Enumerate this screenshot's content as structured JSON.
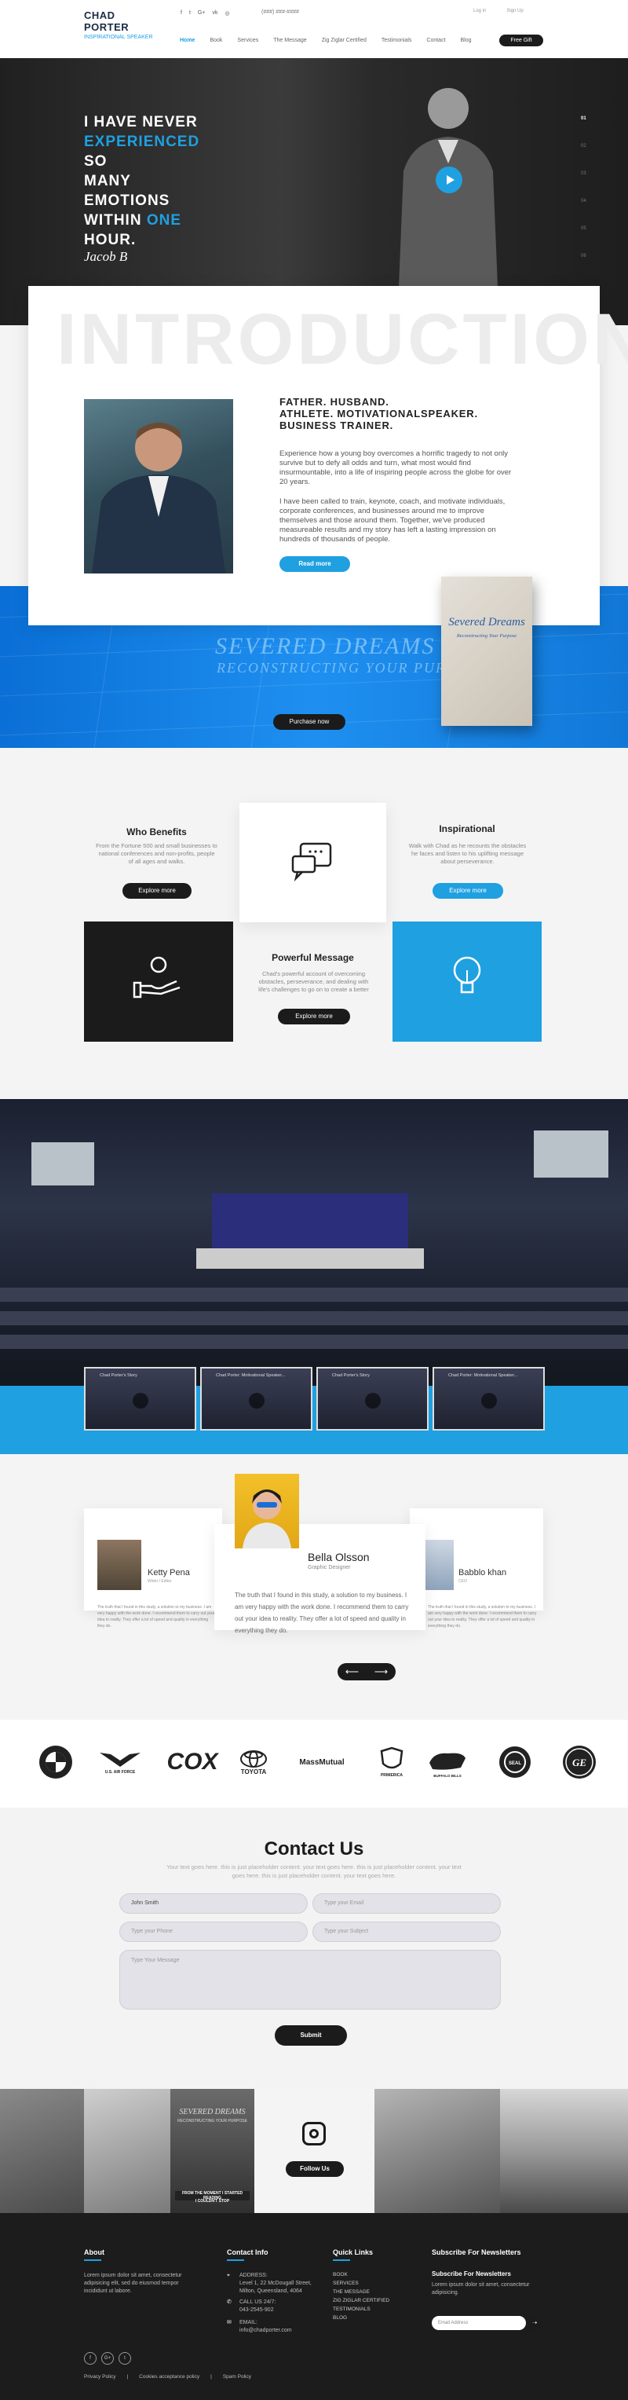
{
  "header": {
    "logo_line1": "CHAD PORTER",
    "logo_line2": "INSPIRATIONAL SPEAKER",
    "social_icons": [
      "facebook-icon",
      "twitter-icon",
      "google-plus-icon",
      "vk-icon",
      "instagram-icon"
    ],
    "phone": "(###) ###-####",
    "top_links": [
      "Log in",
      "Sign Up"
    ],
    "nav": [
      "Home",
      "Book",
      "Services",
      "The Message",
      "Zig Ziglar Certified",
      "Testimonials",
      "Contact",
      "Blog"
    ],
    "cta": "Free Gift",
    "brand_color": "#1fa0e0"
  },
  "hero": {
    "line1": "I HAVE NEVER",
    "line2_accent": "EXPERIENCED",
    "line2_rest": " SO",
    "line3": "MANY EMOTIONS",
    "line4_pre": "WITHIN ",
    "line4_accent": "ONE",
    "line5": "HOUR.",
    "signature": "Jacob B",
    "pager": [
      "01",
      "02",
      "03",
      "04",
      "05",
      "06"
    ]
  },
  "intro": {
    "watermark": "INTRODUCTION",
    "heading_l1": "FATHER. HUSBAND.",
    "heading_l2": "ATHLETE. MOTIVATIONALSPEAKER.",
    "heading_l3": "BUSINESS TRAINER.",
    "para1": "Experience how a young boy overcomes a horrific tragedy to not only survive but to defy all odds and turn, what most would find insurmountable, into a life of inspiring people across the globe for over 20 years.",
    "para2": "I have been called to train, keynote, coach, and motivate individuals, corporate conferences, and businesses around me to improve themselves and those around them. Together, we've produced measureable results and my story has left a lasting impression on hundreds of thousands of people.",
    "read_more": "Read more"
  },
  "book": {
    "title1": "SEVERED DREAMS",
    "title2": "RECONSTRUCTING YOUR PURPOSE",
    "purchase": "Purchase now",
    "cover_title": "Severed Dreams",
    "cover_sub": "Reconstructing Your Purpose"
  },
  "benefits": {
    "who_title": "Who Benefits",
    "who_text": "From the Fortune 500 and small businesses to national conferences and non-profits, people of all ages and walks.",
    "who_btn": "Explore more",
    "insp_title": "Inspirational",
    "insp_text": "Walk with Chad as he recounts the obstacles he faces and listen to his uplifting message about perseverance.",
    "insp_btn": "Explore more",
    "pm_title": "Powerful Message",
    "pm_text": "Chad's powerful account of overcoming obstacles, perseverance, and dealing with life's challenges to go on to create a better",
    "pm_btn": "Explore more"
  },
  "videos": [
    {
      "title": "Chad Porter's Story"
    },
    {
      "title": "Chad Porter: Motivational Speaker..."
    },
    {
      "title": "Chad Porter's Story"
    },
    {
      "title": "Chad Porter: Motivational Speaker..."
    }
  ],
  "testimonials": {
    "left": {
      "name": "Ketty Pena",
      "role": "Writer / Editor",
      "text": "The truth that I found in this study, a solution to my business. I am very happy with the work done. I recommend them to carry out your idea to reality. They offer a lot of speed and quality in everything they do."
    },
    "main": {
      "name": "Bella Olsson",
      "role": "Graphic Designer",
      "text": "The truth that I found in this study, a solution to my business. I am very happy with the work done. I recommend them to carry out your idea to reality. They offer a lot of speed and quality in everything they do."
    },
    "right": {
      "name": "Babblo khan",
      "role": "CEO",
      "text": "The truth that I found in this study, a solution to my business. I am very happy with the work done. I recommend them to carry out your idea to reality. They offer a lot of speed and quality in everything they do."
    },
    "prev": "⟵",
    "next": "⟶"
  },
  "logos": [
    "BMW",
    "U.S. AIR FORCE",
    "COX",
    "TOYOTA",
    "MassMutual",
    "PRIMERICA",
    "BUFFALO BILLS",
    "SEAL",
    "GE"
  ],
  "contact": {
    "title": "Contact Us",
    "sub": "Your text goes here. this is just placeholder content. your text goes here. this is just placeholder content. your text goes here. this is just placeholder content. your text goes here.",
    "name_value": "John Smith",
    "email_ph": "Type your Email",
    "phone_ph": "Type your Phone",
    "subject_ph": "Type your Subject",
    "message_ph": "Type Your Message",
    "submit": "Submit"
  },
  "instagram": {
    "follow": "Follow Us",
    "poster1": "SEVERED DREAMS",
    "poster2": "RECONSTRUCTING YOUR PURPOSE",
    "poster3": "FROM THE MOMENT I STARTED READING",
    "poster4": "I COULDN'T STOP"
  },
  "footer": {
    "about_h": "About",
    "about_text": "Lorem ipsum dolor sit amet, consectetur adipisicing elit, sed do eiusmod tempor incididunt ut labore.",
    "contact_h": "Contact Info",
    "address_label": "ADDRESS:",
    "address": "Level 1, 22 McDougall Street, Milton, Queensland, 4064",
    "call_label": "CALL US 24/7:",
    "call": "043-2545-902",
    "email_label": "EMAIL:",
    "email": "info@chadporter.com",
    "links_h": "Quick Links",
    "links": [
      "BOOK",
      "SERVICES",
      "THE MESSAGE",
      "ZIG ZIGLAR CERTIFIED",
      "TESTIMONIALS",
      "BLOG"
    ],
    "news_h": "Subscribe For Newsletters",
    "news_text": "Lorem ipsum dolor sit amet, consectetur adipisicing.",
    "news_ph": "Email Address",
    "news_go": "➝",
    "bottom": [
      "Privacy Policy",
      "|",
      "Cookies acceptance policy",
      "|",
      "Spam Policy"
    ],
    "social": [
      "f",
      "G+",
      "t"
    ]
  }
}
